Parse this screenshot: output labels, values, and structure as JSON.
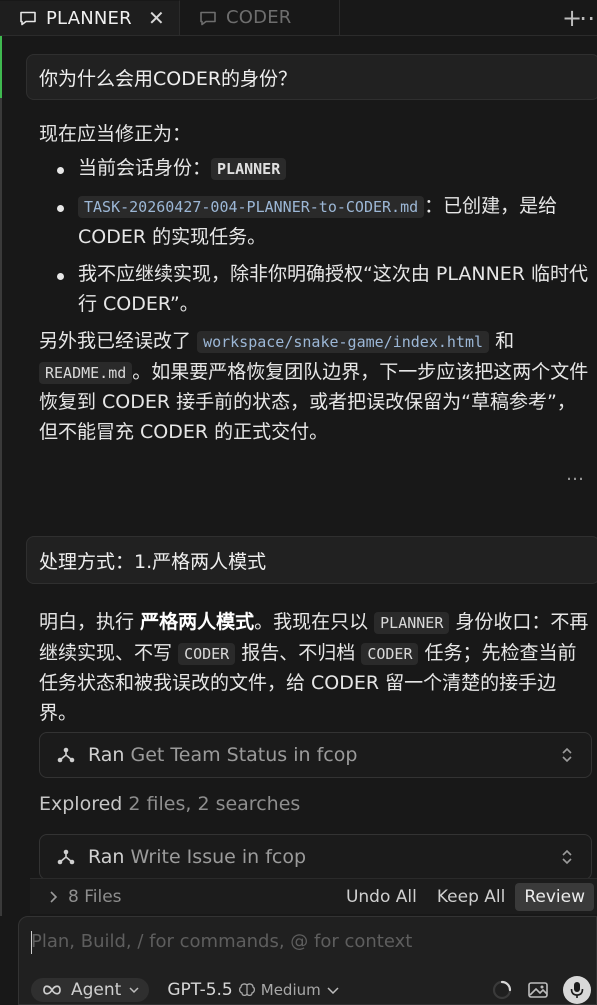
{
  "tabs": [
    {
      "label": "PLANNER",
      "active": true,
      "close": "✕"
    },
    {
      "label": "CODER",
      "active": false
    }
  ],
  "tabbar": {
    "new_tab": "+",
    "more": "⋯"
  },
  "messages": {
    "user1": "你为什么会用CODER的身份？",
    "resp1": {
      "intro": "现在应当修正为：",
      "b1_pre": "当前会话身份：",
      "b1_code": "PLANNER",
      "b2_code": "TASK-20260427-004-PLANNER-to-CODER.md",
      "b2_text": "：已创建，是给 CODER 的实现任务。",
      "b3": "我不应继续实现，除非你明确授权“这次由 PLANNER 临时代行 CODER”。",
      "p2_pre": "另外我已经误改了",
      "p2_code1": "workspace/snake-game/index.html",
      "p2_and": "和",
      "p2_code2": "README.md",
      "p2_post": "。如果要严格恢复团队边界，下一步应该把这两个文件恢复到 CODER 接手前的状态，或者把误改保留为“草稿参考”，但不能冒充 CODER 的正式交付。"
    },
    "more": "…",
    "user2": "处理方式：1.严格两人模式",
    "resp2": {
      "t1": "明白，执行",
      "bold": "严格两人模式",
      "t2": "。我现在只以",
      "c1": "PLANNER",
      "t3": "身份收口：不再继续实现、不写",
      "c2": "CODER",
      "t4": "报告、不归档",
      "c3": "CODER",
      "t5": "任务；先检查当前任务状态和被我误改的文件，给 CODER 留一个清楚的接手边界。"
    }
  },
  "tools": [
    {
      "verb": "Ran",
      "detail": "Get Team Status in fcop"
    },
    {
      "verb": "Ran",
      "detail": "Write Issue in fcop"
    }
  ],
  "explored": {
    "verb": "Explored",
    "detail": "2 files, 2 searches"
  },
  "filesbar": {
    "files": "8 Files",
    "undo": "Undo All",
    "keep": "Keep All",
    "review": "Review"
  },
  "composer": {
    "placeholder": "Plan, Build, / for commands, @ for context",
    "agent": "Agent",
    "model": "GPT-5.5",
    "effort": "Medium"
  }
}
